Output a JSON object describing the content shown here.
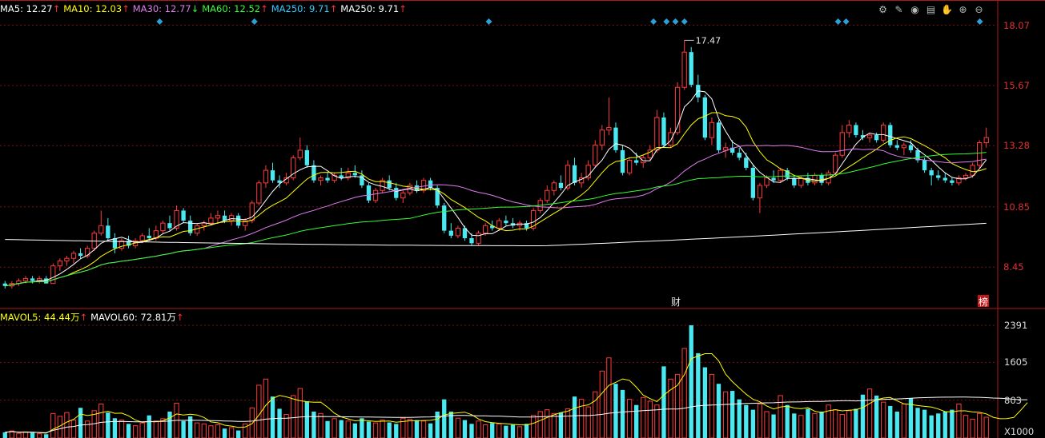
{
  "legend_price": [
    {
      "text": "MA5: 12.27",
      "arrow": "↑",
      "color": "#ffffff",
      "arrow_color": "#ff3333"
    },
    {
      "text": "MA10: 12.03",
      "arrow": "↑",
      "color": "#ffff00",
      "arrow_color": "#ff3333"
    },
    {
      "text": "MA30: 12.77",
      "arrow": "↓",
      "color": "#e07bf0",
      "arrow_color": "#33ff33"
    },
    {
      "text": "MA60: 12.52",
      "arrow": "↑",
      "color": "#33ff33",
      "arrow_color": "#ff3333"
    },
    {
      "text": "MA250: 9.71",
      "arrow": "↑",
      "color": "#33ccff",
      "arrow_color": "#ff3333"
    },
    {
      "text": "MA250: 9.71",
      "arrow": "↑",
      "color": "#ffffff",
      "arrow_color": "#ff3333"
    }
  ],
  "legend_volume": [
    {
      "text": "MAVOL5: 44.44万",
      "arrow": "↑",
      "color": "#ffff00",
      "arrow_color": "#ff3333"
    },
    {
      "text": "MAVOL60: 72.81万",
      "arrow": "↑",
      "color": "#ffffff",
      "arrow_color": "#ff3333"
    }
  ],
  "toolbar": [
    {
      "name": "settings-icon",
      "glyph": "⚙"
    },
    {
      "name": "pen-icon",
      "glyph": "✎"
    },
    {
      "name": "eye-icon",
      "glyph": "◉"
    },
    {
      "name": "print-icon",
      "glyph": "▤"
    },
    {
      "name": "hand-icon",
      "glyph": "✋"
    },
    {
      "name": "zoom-in-icon",
      "glyph": "⊕"
    },
    {
      "name": "zoom-out-icon",
      "glyph": "⊖"
    }
  ],
  "price_axis": [
    "18.07",
    "15.67",
    "13.28",
    "10.85",
    "8.45"
  ],
  "volume_axis": [
    "2391",
    "1605",
    "803"
  ],
  "volume_unit": "X1000",
  "annotations": {
    "peak_label": "17.47",
    "event_cai": "财",
    "event_bang": "榜"
  },
  "colors": {
    "up": "#ff3b3b",
    "down": "#4ae8f0",
    "grid": "#7a1010"
  },
  "chart_data": {
    "type": "candlestick",
    "candles": [
      [
        7.8,
        7.9,
        7.6,
        7.7
      ],
      [
        7.7,
        7.9,
        7.6,
        7.8
      ],
      [
        7.8,
        8.0,
        7.7,
        7.9
      ],
      [
        7.9,
        8.1,
        7.8,
        8.0
      ],
      [
        8.0,
        8.1,
        7.8,
        7.9
      ],
      [
        7.9,
        8.1,
        7.8,
        8.0
      ],
      [
        8.0,
        8.1,
        7.8,
        7.8
      ],
      [
        7.8,
        8.6,
        7.8,
        8.5
      ],
      [
        8.5,
        8.8,
        8.3,
        8.7
      ],
      [
        8.7,
        8.9,
        8.5,
        8.8
      ],
      [
        8.8,
        9.1,
        8.6,
        9.0
      ],
      [
        9.0,
        9.2,
        8.8,
        8.9
      ],
      [
        8.9,
        9.3,
        8.8,
        9.2
      ],
      [
        9.2,
        9.9,
        9.1,
        9.8
      ],
      [
        9.8,
        10.7,
        9.7,
        10.1
      ],
      [
        10.1,
        10.4,
        9.5,
        9.6
      ],
      [
        9.6,
        9.8,
        9.0,
        9.2
      ],
      [
        9.2,
        9.6,
        9.1,
        9.5
      ],
      [
        9.5,
        9.7,
        9.2,
        9.3
      ],
      [
        9.3,
        9.6,
        9.2,
        9.5
      ],
      [
        9.5,
        9.8,
        9.4,
        9.7
      ],
      [
        9.7,
        10.0,
        9.5,
        9.6
      ],
      [
        9.6,
        10.1,
        9.5,
        9.9
      ],
      [
        9.9,
        10.3,
        9.8,
        10.2
      ],
      [
        10.2,
        10.5,
        9.9,
        10.0
      ],
      [
        10.0,
        10.9,
        9.9,
        10.7
      ],
      [
        10.7,
        10.8,
        10.2,
        10.3
      ],
      [
        10.3,
        10.5,
        9.7,
        9.8
      ],
      [
        9.8,
        10.2,
        9.7,
        10.1
      ],
      [
        10.1,
        10.3,
        9.9,
        10.2
      ],
      [
        10.2,
        10.6,
        10.1,
        10.4
      ],
      [
        10.4,
        10.7,
        10.2,
        10.5
      ],
      [
        10.5,
        10.7,
        10.2,
        10.3
      ],
      [
        10.3,
        10.6,
        10.1,
        10.5
      ],
      [
        10.5,
        10.6,
        10.0,
        10.1
      ],
      [
        10.1,
        10.4,
        9.9,
        10.3
      ],
      [
        10.3,
        11.1,
        10.2,
        11.0
      ],
      [
        11.0,
        11.9,
        10.9,
        11.8
      ],
      [
        11.8,
        12.5,
        11.6,
        12.3
      ],
      [
        12.3,
        12.6,
        11.8,
        11.9
      ],
      [
        11.9,
        12.1,
        11.6,
        11.8
      ],
      [
        11.8,
        12.2,
        11.7,
        12.0
      ],
      [
        12.0,
        12.9,
        11.9,
        12.8
      ],
      [
        12.8,
        13.6,
        12.7,
        13.1
      ],
      [
        13.1,
        13.3,
        12.4,
        12.5
      ],
      [
        12.5,
        12.7,
        11.8,
        11.9
      ],
      [
        11.9,
        12.1,
        11.7,
        12.0
      ],
      [
        12.0,
        12.2,
        11.8,
        11.9
      ],
      [
        11.9,
        12.2,
        11.8,
        12.1
      ],
      [
        12.1,
        12.4,
        11.9,
        12.0
      ],
      [
        12.0,
        12.4,
        11.9,
        12.2
      ],
      [
        12.2,
        12.5,
        12.0,
        12.1
      ],
      [
        12.1,
        12.3,
        11.6,
        11.7
      ],
      [
        11.7,
        11.8,
        11.0,
        11.1
      ],
      [
        11.1,
        11.6,
        11.0,
        11.5
      ],
      [
        11.5,
        12.0,
        11.4,
        11.9
      ],
      [
        11.9,
        12.1,
        11.5,
        11.6
      ],
      [
        11.6,
        11.8,
        11.1,
        11.2
      ],
      [
        11.2,
        11.5,
        11.0,
        11.4
      ],
      [
        11.4,
        11.8,
        11.3,
        11.7
      ],
      [
        11.7,
        11.9,
        11.4,
        11.5
      ],
      [
        11.5,
        12.0,
        11.4,
        11.9
      ],
      [
        11.9,
        12.0,
        11.5,
        11.6
      ],
      [
        11.6,
        11.7,
        10.8,
        10.9
      ],
      [
        10.9,
        11.0,
        9.8,
        9.9
      ],
      [
        9.9,
        10.2,
        9.6,
        9.7
      ],
      [
        9.7,
        10.1,
        9.6,
        10.0
      ],
      [
        10.0,
        10.1,
        9.5,
        9.6
      ],
      [
        9.6,
        9.8,
        9.3,
        9.4
      ],
      [
        9.4,
        9.9,
        9.3,
        9.8
      ],
      [
        9.8,
        10.2,
        9.7,
        10.1
      ],
      [
        10.1,
        10.3,
        9.9,
        10.0
      ],
      [
        10.0,
        10.4,
        9.9,
        10.3
      ],
      [
        10.3,
        10.5,
        10.1,
        10.2
      ],
      [
        10.2,
        10.4,
        10.0,
        10.1
      ],
      [
        10.1,
        10.3,
        9.9,
        10.2
      ],
      [
        10.2,
        10.3,
        9.9,
        10.0
      ],
      [
        10.0,
        10.8,
        9.9,
        10.7
      ],
      [
        10.7,
        11.2,
        10.6,
        11.1
      ],
      [
        11.1,
        11.7,
        11.0,
        11.5
      ],
      [
        11.5,
        11.9,
        11.3,
        11.8
      ],
      [
        11.8,
        12.1,
        11.5,
        11.6
      ],
      [
        11.6,
        12.7,
        11.5,
        12.5
      ],
      [
        12.5,
        12.8,
        11.7,
        11.8
      ],
      [
        11.8,
        12.2,
        11.6,
        12.0
      ],
      [
        12.0,
        12.7,
        11.9,
        12.5
      ],
      [
        12.5,
        13.5,
        12.4,
        13.3
      ],
      [
        13.3,
        14.1,
        13.1,
        13.9
      ],
      [
        13.9,
        15.2,
        13.7,
        14.0
      ],
      [
        14.0,
        14.2,
        13.0,
        13.1
      ],
      [
        13.1,
        13.3,
        12.1,
        12.2
      ],
      [
        12.2,
        12.8,
        12.1,
        12.7
      ],
      [
        12.7,
        13.0,
        12.5,
        12.6
      ],
      [
        12.6,
        12.9,
        12.4,
        12.8
      ],
      [
        12.8,
        13.3,
        12.7,
        13.1
      ],
      [
        13.1,
        14.7,
        13.0,
        14.4
      ],
      [
        14.4,
        14.6,
        13.2,
        13.3
      ],
      [
        13.3,
        14.0,
        13.2,
        13.8
      ],
      [
        13.8,
        15.8,
        13.7,
        15.6
      ],
      [
        15.6,
        17.47,
        15.5,
        17.0
      ],
      [
        17.0,
        17.2,
        15.6,
        15.7
      ],
      [
        15.7,
        16.1,
        15.0,
        15.2
      ],
      [
        15.2,
        15.3,
        13.5,
        13.6
      ],
      [
        13.6,
        14.4,
        13.3,
        14.2
      ],
      [
        14.2,
        14.3,
        13.0,
        13.1
      ],
      [
        13.1,
        13.4,
        12.8,
        13.2
      ],
      [
        13.2,
        13.5,
        12.9,
        13.0
      ],
      [
        13.0,
        13.2,
        12.7,
        12.8
      ],
      [
        12.8,
        13.0,
        12.3,
        12.4
      ],
      [
        12.4,
        12.5,
        11.1,
        11.2
      ],
      [
        11.2,
        11.8,
        10.6,
        11.7
      ],
      [
        11.7,
        12.1,
        11.6,
        12.0
      ],
      [
        12.0,
        12.3,
        11.8,
        11.9
      ],
      [
        11.9,
        12.4,
        11.8,
        12.3
      ],
      [
        12.3,
        12.4,
        11.9,
        12.0
      ],
      [
        12.0,
        12.1,
        11.6,
        11.7
      ],
      [
        11.7,
        12.1,
        11.6,
        12.0
      ],
      [
        12.0,
        12.2,
        11.7,
        11.8
      ],
      [
        11.8,
        12.2,
        11.7,
        12.1
      ],
      [
        12.1,
        12.2,
        11.7,
        11.8
      ],
      [
        11.8,
        12.3,
        11.7,
        12.2
      ],
      [
        12.2,
        13.0,
        12.1,
        12.9
      ],
      [
        12.9,
        14.1,
        12.8,
        13.8
      ],
      [
        13.8,
        14.3,
        13.6,
        14.1
      ],
      [
        14.1,
        14.2,
        13.6,
        13.7
      ],
      [
        13.7,
        13.9,
        13.5,
        13.6
      ],
      [
        13.6,
        13.8,
        13.4,
        13.7
      ],
      [
        13.7,
        13.8,
        13.4,
        13.5
      ],
      [
        13.5,
        14.2,
        13.4,
        14.1
      ],
      [
        14.1,
        14.2,
        13.2,
        13.3
      ],
      [
        13.3,
        13.5,
        13.1,
        13.2
      ],
      [
        13.2,
        13.4,
        12.9,
        13.3
      ],
      [
        13.3,
        13.5,
        13.0,
        13.1
      ],
      [
        13.1,
        13.2,
        12.6,
        12.7
      ],
      [
        12.7,
        12.8,
        12.2,
        12.3
      ],
      [
        12.3,
        12.4,
        11.7,
        12.1
      ],
      [
        12.1,
        12.3,
        11.9,
        12.0
      ],
      [
        12.0,
        12.2,
        11.8,
        11.9
      ],
      [
        11.9,
        12.0,
        11.7,
        11.8
      ],
      [
        11.8,
        12.1,
        11.7,
        12.0
      ],
      [
        12.0,
        12.2,
        11.9,
        12.1
      ],
      [
        12.1,
        12.6,
        12.0,
        12.5
      ],
      [
        12.5,
        13.5,
        12.4,
        13.4
      ],
      [
        13.4,
        14.0,
        13.2,
        13.6
      ]
    ],
    "volume": [
      120,
      150,
      100,
      130,
      110,
      90,
      80,
      520,
      460,
      540,
      380,
      640,
      360,
      580,
      720,
      540,
      420,
      380,
      300,
      260,
      320,
      480,
      360,
      410,
      560,
      740,
      360,
      460,
      320,
      300,
      260,
      280,
      200,
      220,
      160,
      300,
      640,
      1120,
      1250,
      880,
      620,
      500,
      900,
      1050,
      780,
      560,
      520,
      360,
      410,
      380,
      360,
      310,
      420,
      350,
      320,
      380,
      330,
      300,
      420,
      400,
      380,
      360,
      310,
      560,
      820,
      560,
      420,
      380,
      300,
      360,
      280,
      320,
      300,
      260,
      280,
      240,
      300,
      480,
      560,
      600,
      520,
      540,
      620,
      880,
      820,
      660,
      980,
      1420,
      1700,
      1150,
      1020,
      820,
      700,
      860,
      780,
      700,
      1520,
      1250,
      1350,
      1900,
      2391,
      1800,
      1500,
      1350,
      1150,
      980,
      1000,
      820,
      700,
      600,
      720,
      560,
      500,
      900,
      700,
      520,
      480,
      620,
      520,
      560,
      700,
      600,
      500,
      580,
      620,
      920,
      1040,
      900,
      760,
      680,
      560,
      720,
      840,
      640,
      600,
      480,
      520,
      560,
      600,
      720,
      480,
      400,
      520,
      440,
      360,
      320,
      420,
      640,
      1200,
      1180
    ],
    "price_ylim": [
      6.9,
      18.5
    ],
    "volume_ylim": [
      0,
      2391
    ],
    "ma5_last": 12.27,
    "ma10_last": 12.03,
    "ma30_last": 12.77,
    "ma60_last": 12.52,
    "ma250_last": 9.71,
    "event_markers_x": [
      0.16,
      0.255,
      0.49,
      0.655,
      0.668,
      0.677,
      0.686,
      0.84,
      0.848,
      0.982
    ]
  }
}
